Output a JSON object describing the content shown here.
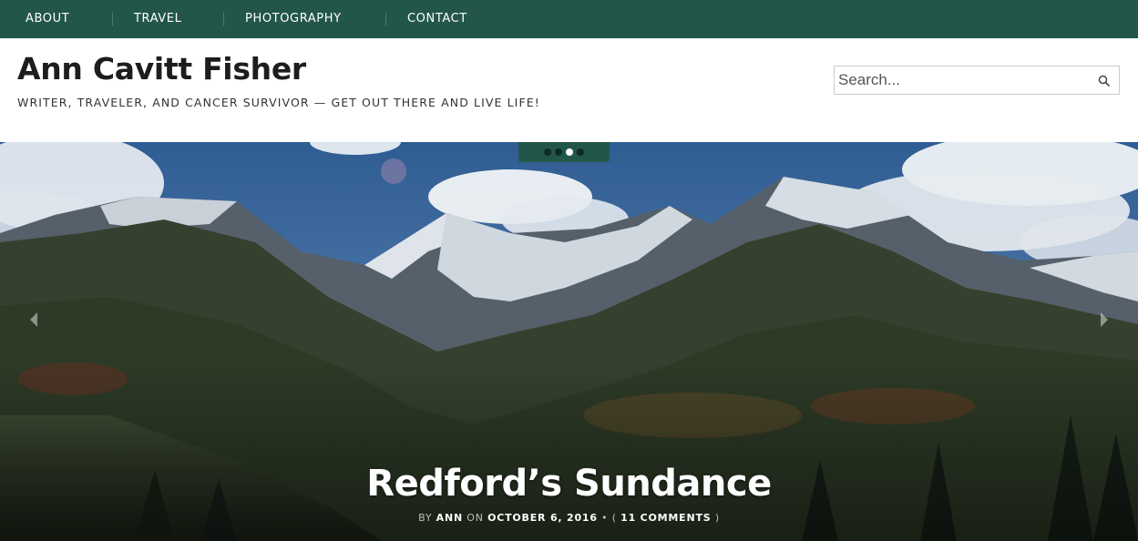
{
  "nav": {
    "items": [
      {
        "label": "ABOUT"
      },
      {
        "label": "TRAVEL"
      },
      {
        "label": "PHOTOGRAPHY"
      },
      {
        "label": "CONTACT"
      }
    ]
  },
  "header": {
    "site_title": "Ann Cavitt Fisher",
    "tagline": "WRITER, TRAVELER, AND CANCER SURVIVOR — GET OUT THERE AND LIVE LIFE!"
  },
  "search": {
    "placeholder": "Search...",
    "icon": "search-icon"
  },
  "slider": {
    "slide_count": 4,
    "active_index": 2,
    "title": "Redford’s Sundance",
    "meta": {
      "by": "BY",
      "author": "ANN",
      "on": "ON",
      "date": "OCTOBER 6, 2016",
      "bullet": "•",
      "paren_open": "(",
      "comments": "11 COMMENTS",
      "paren_close": ")"
    },
    "prev_icon": "chevron-left-icon",
    "next_icon": "chevron-right-icon"
  },
  "colors": {
    "nav_bg": "#22564a",
    "title_text": "#1d1d1d"
  }
}
